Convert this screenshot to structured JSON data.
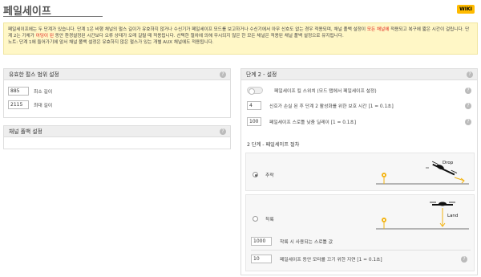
{
  "header": {
    "title": "페일세이프",
    "wiki_label": "WIKI"
  },
  "notice": {
    "part1": "페일세이프에는 두 단계가 있습니다. 단계 1은 비행 채널의 펄스 길이가 유효하지 않거나 수신기가 페일세이프 모드를 보고하거나 수신기에서 아무 신호도 없는 경우 적용되며, 채널 폴백 설정이 ",
    "red1": "모든 채널에",
    "part2": " 적용되고 복구에 짧은 시간이 걸립니다. 단계 2는 기체가 ",
    "red2": "어딩이 된",
    "part3": " 동안 환경설정된 시간보다 오류 상태가 오래 길릴 때 적용됩니다. 선택한 절차에 의해 무시되지 않은 한 모든 채널은 적용된 채널 폴백 설정으로 유지됩니다.",
    "line2": "노트: 단계 1에 들어가기에 앞서 채널 폴백 설정은 유효하지 않은 펄스가 있는 개별 AUX 채널에도 적용됩니다."
  },
  "pulse_panel": {
    "title": "유효한 펄스 범위 설정",
    "min_value": "885",
    "min_label": "최소 길이",
    "max_value": "2115",
    "max_label": "최대 길이"
  },
  "fallback_panel": {
    "title": "채널 폴백 설정"
  },
  "stage2": {
    "title": "단계 2 - 설정",
    "switch_label": "페일세이프 킬 스위치 (모드 탭에서 페일세이프 설정)",
    "guard_value": "4",
    "guard_label": "신호가 손실 된 후 단계 2 활성화를 위한 보호 시간 [1 = 0.1초]",
    "delay_value": "100",
    "delay_label": "페일세이프 스로틀 낮춤 딜레이 [1 = 0.1초]",
    "procedure_title": "2 단계 - 페일세이프 절차",
    "drop_label": "추락",
    "drop_img_label": "Drop",
    "land_label": "착륙",
    "land_img_label": "Land",
    "throttle_value": "1000",
    "throttle_label": "착륙 시 사용되는 스로틀 값",
    "motor_value": "10",
    "motor_label": "페일세이프 동안 모터를 끄기 위한 지연 [1 = 0.1초]"
  },
  "help_glyph": "?"
}
